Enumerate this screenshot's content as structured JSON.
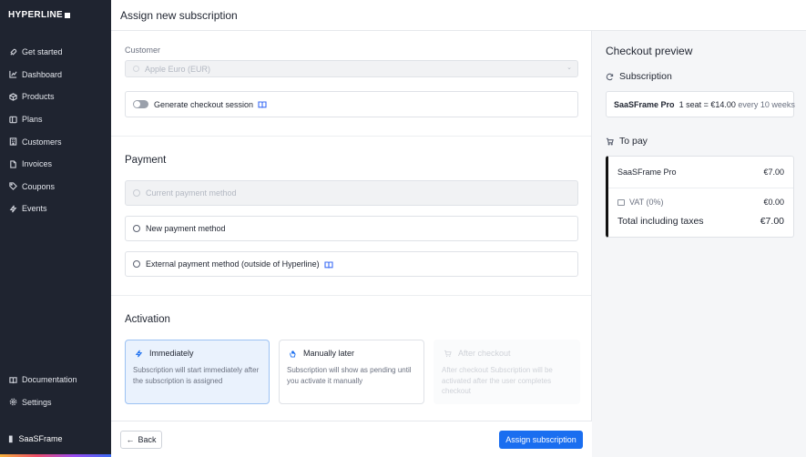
{
  "brand": {
    "name": "HYPERLINE"
  },
  "sidebar": {
    "items": [
      {
        "label": "Get started",
        "icon": "rocket-icon"
      },
      {
        "label": "Dashboard",
        "icon": "chart-icon"
      },
      {
        "label": "Products",
        "icon": "box-icon"
      },
      {
        "label": "Plans",
        "icon": "layers-icon"
      },
      {
        "label": "Customers",
        "icon": "building-icon"
      },
      {
        "label": "Invoices",
        "icon": "file-icon"
      },
      {
        "label": "Coupons",
        "icon": "tag-icon"
      },
      {
        "label": "Events",
        "icon": "lightning-icon"
      }
    ],
    "bottom": [
      {
        "label": "Documentation",
        "icon": "book-icon"
      },
      {
        "label": "Settings",
        "icon": "gear-icon"
      }
    ],
    "workspace": "SaaSFrame"
  },
  "header": {
    "title": "Assign new subscription"
  },
  "form": {
    "customer_label": "Customer",
    "customer_value": "Apple  Euro (EUR)",
    "checkout_toggle_label": "Generate checkout session",
    "payment_title": "Payment",
    "payment_options": {
      "current": "Current payment method",
      "new": "New payment method",
      "external": "External payment method (outside of Hyperline)"
    },
    "activation_title": "Activation",
    "activation": {
      "immediately": {
        "title": "Immediately",
        "desc": "Subscription will start immediately after the subscription is assigned"
      },
      "manual": {
        "title": "Manually later",
        "desc": "Subscription will show as pending until you activate it manually"
      },
      "checkout": {
        "title": "After checkout",
        "desc": "After checkout Subscription will be activated after the user completes checkout"
      }
    }
  },
  "footer": {
    "back": "Back",
    "assign": "Assign subscription"
  },
  "preview": {
    "title": "Checkout preview",
    "subscription_label": "Subscription",
    "subscription": {
      "plan": "SaaSFrame Pro",
      "detail": "1 seat = €14.00",
      "period": "every 10 weeks"
    },
    "to_pay_label": "To pay",
    "lines": {
      "item": "SaaSFrame Pro",
      "item_amount": "€7.00",
      "vat": "VAT (0%)",
      "vat_amount": "€0.00",
      "total": "Total including taxes",
      "total_amount": "€7.00"
    }
  },
  "colors": {
    "primary": "#1a6ef0",
    "sidebar": "#1f2430",
    "selected_bg": "#eaf2fd"
  }
}
